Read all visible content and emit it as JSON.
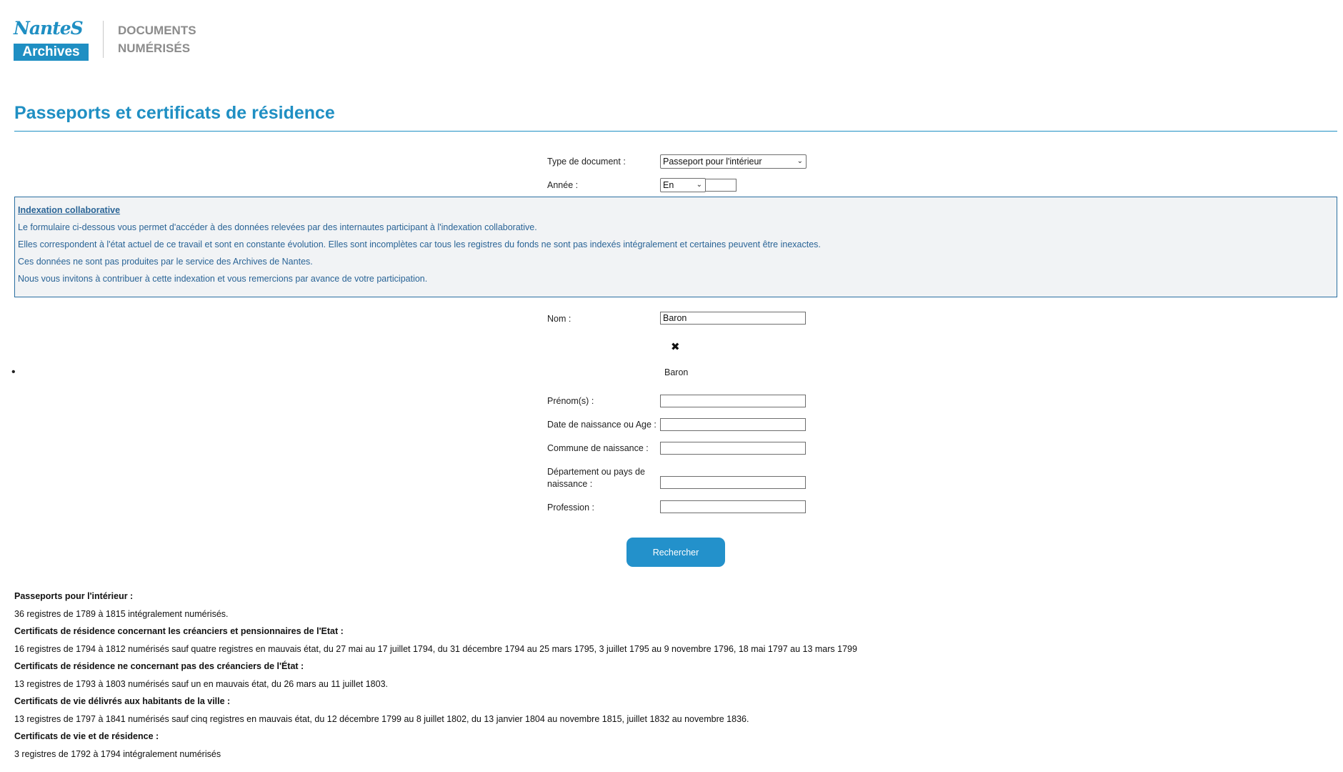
{
  "header": {
    "logo_word": "NanteS",
    "logo_box": "Archives",
    "tagline_line1": "DOCUMENTS",
    "tagline_line2": "NUMÉRISÉS"
  },
  "page_title": "Passeports et certificats de résidence",
  "form": {
    "type_label": "Type de document :",
    "type_value": "Passeport pour l'intérieur",
    "year_label": "Année :",
    "year_mode": "En",
    "year_value": "",
    "name_label": "Nom :",
    "name_value": "Baron",
    "suggestion": "Baron",
    "firstname_label": "Prénom(s) :",
    "birthdate_label": "Date de naissance ou Age :",
    "birthplace_label": "Commune de naissance :",
    "dept_label_line1": "Département ou pays de",
    "dept_label_line2": "naissance :",
    "profession_label": "Profession :",
    "search_button": "Rechercher"
  },
  "info_box": {
    "title": "Indexation collaborative",
    "lines": [
      " Le formulaire ci-dessous vous permet d'accéder à des données relevées par des internautes participant à l'indexation collaborative.",
      "Elles correspondent à l'état actuel de ce travail et sont en constante évolution. Elles sont incomplètes car tous les registres du fonds ne sont pas indexés intégralement et certaines peuvent être inexactes.",
      "Ces données ne sont pas produites par le service des Archives de Nantes.",
      "Nous vous invitons à contribuer à cette indexation et vous remercions par avance de votre participation."
    ]
  },
  "descriptions": [
    {
      "heading": "Passeports pour l'intérieur :",
      "text": "36 registres de 1789 à 1815 intégralement numérisés."
    },
    {
      "heading": "Certificats de résidence concernant les créanciers et pensionnaires de l'Etat :",
      "text": "16 registres de 1794 à 1812 numérisés sauf quatre registres en mauvais état, du 27 mai au 17 juillet 1794, du 31 décembre 1794 au 25 mars 1795, 3 juillet 1795 au 9 novembre 1796, 18 mai 1797 au 13 mars 1799"
    },
    {
      "heading": "Certificats de résidence ne concernant pas des créanciers de l'État :",
      "text": "13 registres de 1793 à 1803 numérisés sauf un en mauvais état, du 26 mars au 11 juillet 1803."
    },
    {
      "heading": "Certificats de vie délivrés aux habitants de la ville :",
      "text": "13 registres de 1797 à 1841 numérisés sauf cinq registres en mauvais état, du 12 décembre 1799 au 8 juillet 1802, du 13 janvier 1804 au novembre 1815, juillet 1832 au novembre 1836."
    },
    {
      "heading": "Certificats de vie et de résidence :",
      "text": "3 registres de 1792 à 1794 intégralement numérisés"
    }
  ]
}
